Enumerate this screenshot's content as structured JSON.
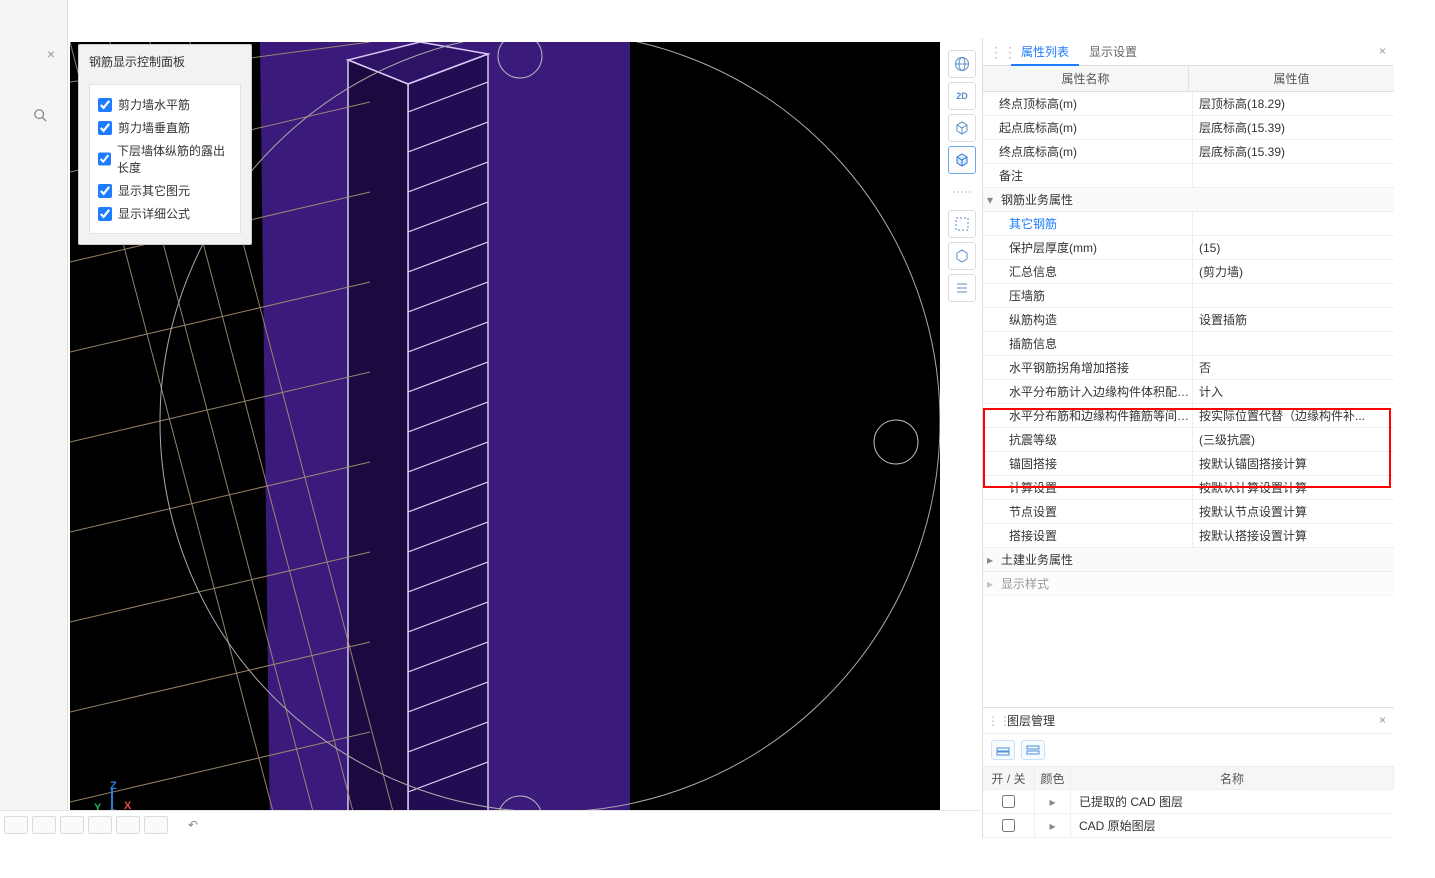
{
  "control_panel": {
    "title": "钢筋显示控制面板",
    "items": [
      "剪力墙水平筋",
      "剪力墙垂直筋",
      "下层墙体纵筋的露出长度",
      "显示其它图元",
      "显示详细公式"
    ]
  },
  "tabs": {
    "properties": "属性列表",
    "display": "显示设置"
  },
  "prop_header": {
    "name": "属性名称",
    "value": "属性值"
  },
  "properties": [
    {
      "k": "终点顶标高(m)",
      "v": "层顶标高(18.29)"
    },
    {
      "k": "起点底标高(m)",
      "v": "层底标高(15.39)"
    },
    {
      "k": "终点底标高(m)",
      "v": "层底标高(15.39)"
    },
    {
      "k": "备注",
      "v": ""
    }
  ],
  "group1": "钢筋业务属性",
  "group1_rows": [
    {
      "k": "其它钢筋",
      "v": "",
      "link": true
    },
    {
      "k": "保护层厚度(mm)",
      "v": "(15)"
    },
    {
      "k": "汇总信息",
      "v": "(剪力墙)"
    },
    {
      "k": "压墙筋",
      "v": ""
    },
    {
      "k": "纵筋构造",
      "v": "设置插筋"
    },
    {
      "k": "插筋信息",
      "v": ""
    },
    {
      "k": "水平钢筋拐角增加搭接",
      "v": "否"
    },
    {
      "k": "水平分布筋计入边缘构件体积配箍率",
      "v": "计入"
    },
    {
      "k": "水平分布筋和边缘构件箍筋等间距时",
      "v": "按实际位置代替（边缘构件补..."
    },
    {
      "k": "抗震等级",
      "v": "(三级抗震)"
    },
    {
      "k": "锚固搭接",
      "v": "按默认锚固搭接计算"
    },
    {
      "k": "计算设置",
      "v": "按默认计算设置计算"
    },
    {
      "k": "节点设置",
      "v": "按默认节点设置计算"
    },
    {
      "k": "搭接设置",
      "v": "按默认搭接设置计算"
    }
  ],
  "group2": "土建业务属性",
  "group3": "显示样式",
  "layer_panel": {
    "title": "图层管理",
    "header": {
      "onoff": "开 / 关",
      "color": "颜色",
      "name": "名称"
    },
    "rows": [
      {
        "name": "已提取的 CAD 图层"
      },
      {
        "name": "CAD 原始图层"
      }
    ]
  },
  "view_toolbar": [
    "globe",
    "2D",
    "cube-wire",
    "cube-solid",
    "dotted-line",
    "select-box",
    "cube-iso",
    "list"
  ],
  "axis": {
    "x": "X",
    "y": "Y",
    "z": "Z"
  }
}
